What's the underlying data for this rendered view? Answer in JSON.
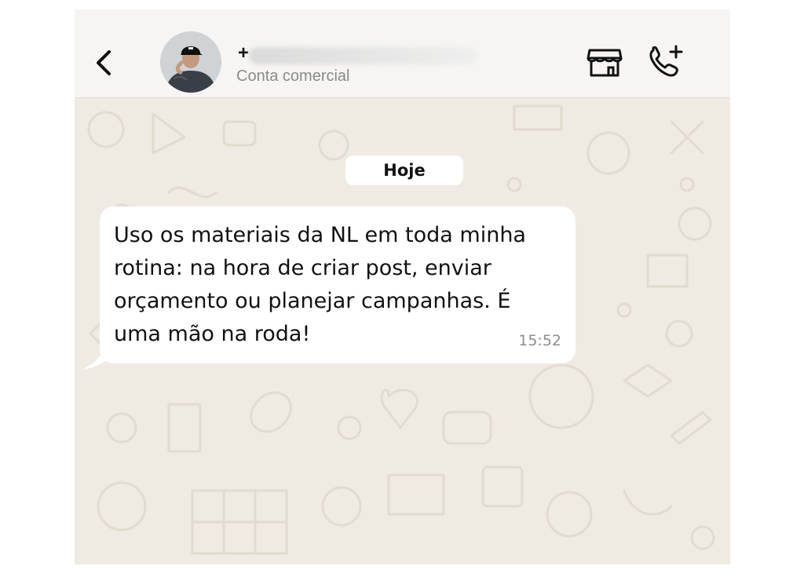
{
  "header": {
    "back_icon": "chevron-left-icon",
    "contact": {
      "name_prefix": "+",
      "subtitle": "Conta comercial"
    },
    "store_icon": "storefront-icon",
    "call_icon": "add-call-icon"
  },
  "chat": {
    "date_label": "Hoje",
    "messages": [
      {
        "text": "Uso os materiais da NL em toda minha\nrotina: na hora de criar post, enviar\norçamento ou planejar campanhas. É\numa mão na roda!",
        "time": "15:52"
      }
    ]
  },
  "colors": {
    "chat_background": "#efeae2",
    "header_background": "#f6f5f3",
    "bubble": "#ffffff",
    "time_text": "#8e8e8e"
  }
}
